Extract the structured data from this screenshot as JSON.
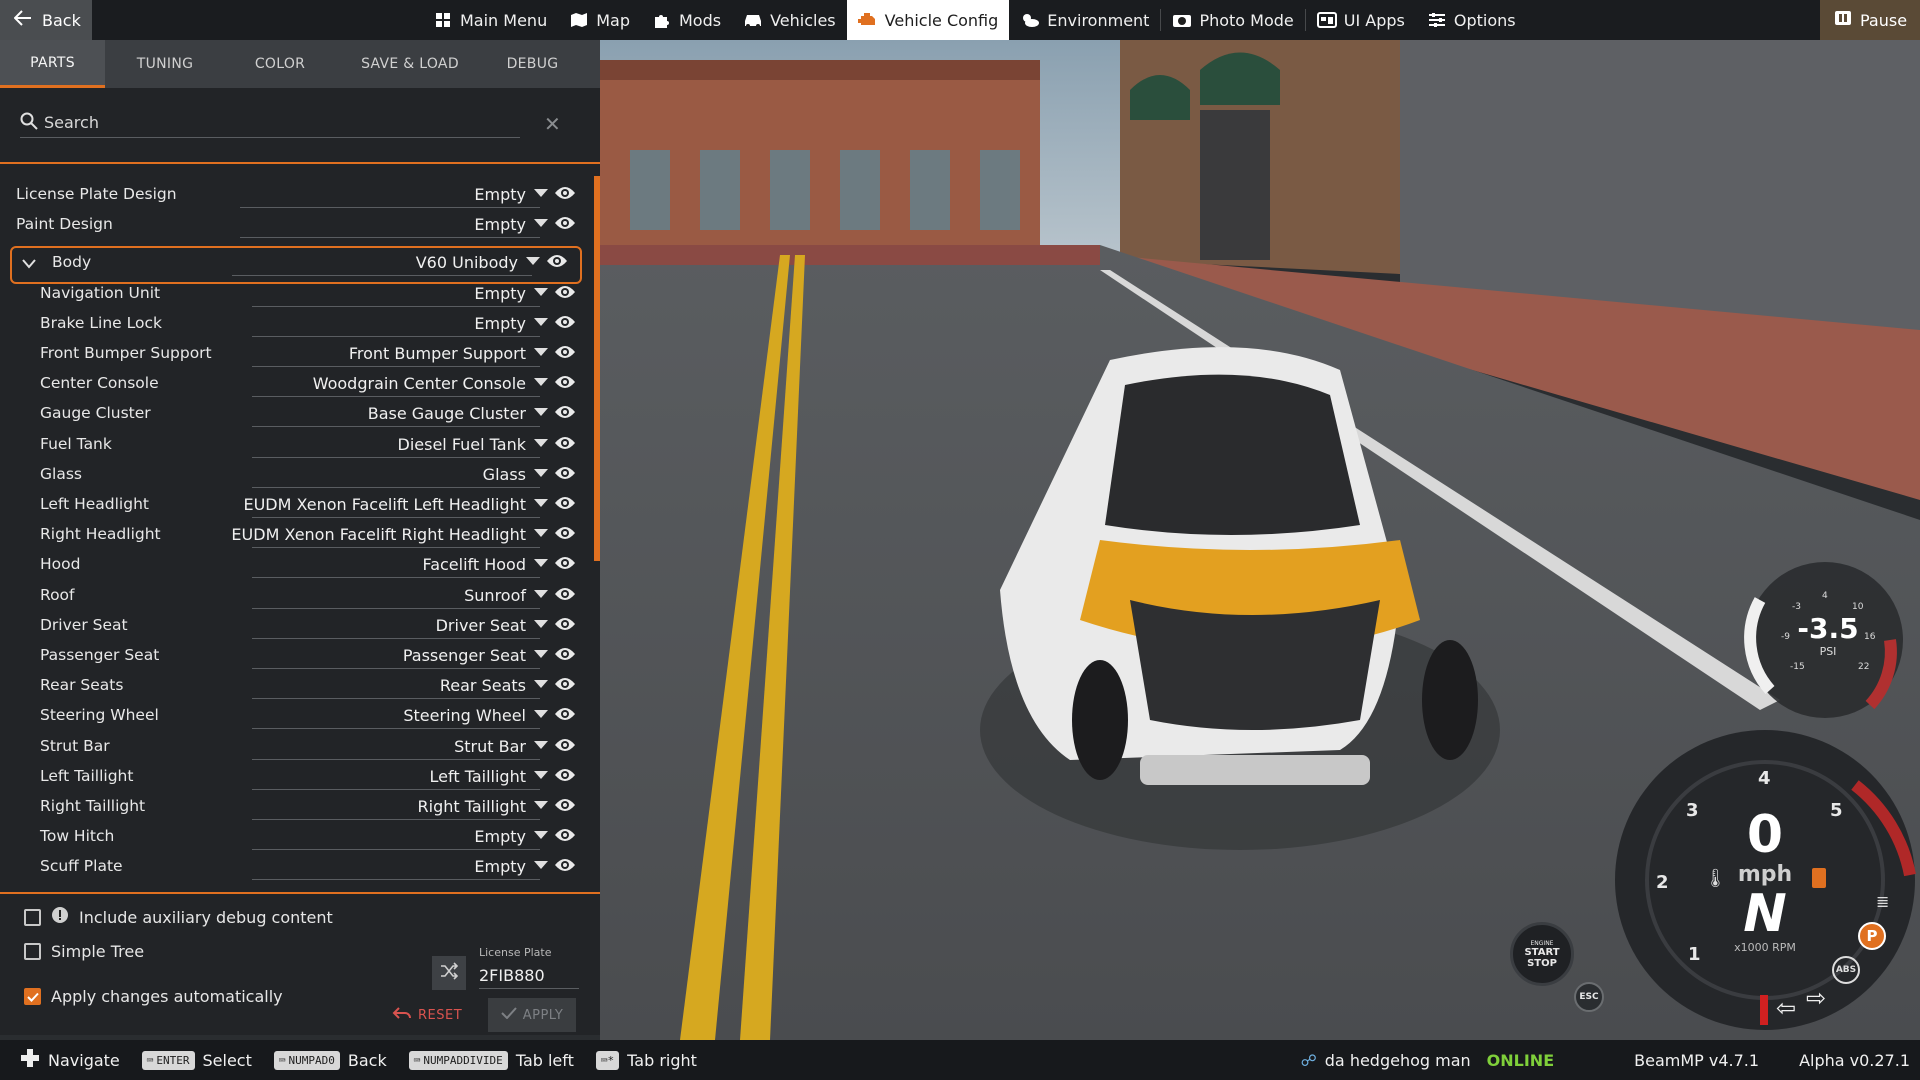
{
  "topbar": {
    "back_label": "Back",
    "nav": [
      {
        "label": "Main Menu",
        "icon": "grid-icon"
      },
      {
        "label": "Map",
        "icon": "map-icon"
      },
      {
        "label": "Mods",
        "icon": "puzzle-icon"
      },
      {
        "label": "Vehicles",
        "icon": "car-icon"
      },
      {
        "label": "Vehicle Config",
        "icon": "engine-icon",
        "active": true
      },
      {
        "label": "Environment",
        "icon": "weather-icon"
      },
      {
        "label": "Photo Mode",
        "icon": "camera-icon"
      },
      {
        "label": "UI Apps",
        "icon": "apps-icon"
      },
      {
        "label": "Options",
        "icon": "sliders-icon"
      }
    ],
    "pause_label": "Pause"
  },
  "tabs": [
    "PARTS",
    "TUNING",
    "COLOR",
    "SAVE & LOAD",
    "DEBUG"
  ],
  "active_tab": "PARTS",
  "search": {
    "placeholder": "Search"
  },
  "parts": [
    {
      "label": "License Plate Design",
      "value": "Empty",
      "level": 0
    },
    {
      "label": "Paint Design",
      "value": "Empty",
      "level": 0
    },
    {
      "label": "Body",
      "value": "V60 Unibody",
      "level": 0,
      "expanded": true,
      "selected": true
    },
    {
      "label": "Navigation Unit",
      "value": "Empty",
      "level": 1
    },
    {
      "label": "Brake Line Lock",
      "value": "Empty",
      "level": 1
    },
    {
      "label": "Front Bumper Support",
      "value": "Front Bumper Support",
      "level": 1
    },
    {
      "label": "Center Console",
      "value": "Woodgrain Center Console",
      "level": 1
    },
    {
      "label": "Gauge Cluster",
      "value": "Base Gauge Cluster",
      "level": 1
    },
    {
      "label": "Fuel Tank",
      "value": "Diesel Fuel Tank",
      "level": 1
    },
    {
      "label": "Glass",
      "value": "Glass",
      "level": 1
    },
    {
      "label": "Left Headlight",
      "value": "EUDM Xenon Facelift Left Headlight",
      "level": 1
    },
    {
      "label": "Right Headlight",
      "value": "EUDM Xenon Facelift Right Headlight",
      "level": 1
    },
    {
      "label": "Hood",
      "value": "Facelift Hood",
      "level": 1
    },
    {
      "label": "Roof",
      "value": "Sunroof",
      "level": 1
    },
    {
      "label": "Driver Seat",
      "value": "Driver Seat",
      "level": 1
    },
    {
      "label": "Passenger Seat",
      "value": "Passenger Seat",
      "level": 1
    },
    {
      "label": "Rear Seats",
      "value": "Rear Seats",
      "level": 1
    },
    {
      "label": "Steering Wheel",
      "value": "Steering Wheel",
      "level": 1
    },
    {
      "label": "Strut Bar",
      "value": "Strut Bar",
      "level": 1
    },
    {
      "label": "Left Taillight",
      "value": "Left Taillight",
      "level": 1
    },
    {
      "label": "Right Taillight",
      "value": "Right Taillight",
      "level": 1
    },
    {
      "label": "Tow Hitch",
      "value": "Empty",
      "level": 1
    },
    {
      "label": "Scuff Plate",
      "value": "Empty",
      "level": 1
    }
  ],
  "options": {
    "aux_debug": "Include auxiliary debug content",
    "simple_tree": "Simple Tree",
    "apply_auto": "Apply changes automatically",
    "apply_auto_checked": true
  },
  "license_plate": {
    "label": "License Plate",
    "value": "2FIB880"
  },
  "buttons": {
    "reset": "RESET",
    "apply": "APPLY"
  },
  "statusbar": {
    "hints": [
      {
        "key": "",
        "label": "Navigate"
      },
      {
        "key": "ENTER",
        "label": "Select"
      },
      {
        "key": "NUMPAD0",
        "label": "Back"
      },
      {
        "key": "NUMPADDIVIDE",
        "label": "Tab left"
      },
      {
        "key": "",
        "label": "Tab right"
      }
    ],
    "user": "da hedgehog man",
    "online": "ONLINE",
    "beammp": "BeamMP v4.7.1",
    "version": "Alpha v0.27.1"
  },
  "gauges": {
    "boost_value": "-3.5",
    "boost_unit": "PSI",
    "boost_ticks": [
      "-3",
      "4",
      "10",
      "-9",
      "16",
      "-15",
      "22"
    ],
    "speed": "0",
    "speed_unit": "mph",
    "gear": "N",
    "rpm_unit": "x1000 RPM",
    "rpm_ticks": [
      "1",
      "2",
      "3",
      "4",
      "5"
    ],
    "engine_btn_top": "ENGINE",
    "engine_btn_main": "START STOP",
    "esc": "ESC",
    "abs": "ABS",
    "park": "P"
  },
  "colors": {
    "accent": "#e07020",
    "online": "#7fcf3a",
    "reset": "#d9534f"
  }
}
